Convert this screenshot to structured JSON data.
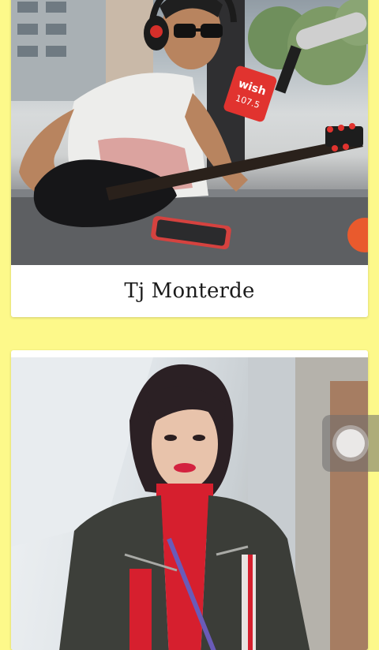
{
  "cards": [
    {
      "title": "Tj Monterde",
      "image": "artist-photo-man-with-guitar-at-microphone",
      "mic_logo_text": "wish 107.5"
    },
    {
      "title": "",
      "image": "artist-photo-woman-in-jacket"
    }
  ],
  "floating_button": {
    "icon": "assistive-touch-icon"
  },
  "colors": {
    "page_background": "#fdf98a",
    "card_background": "#ffffff",
    "caption_text": "#1a1a1a",
    "brand_red": "#e1332f"
  }
}
